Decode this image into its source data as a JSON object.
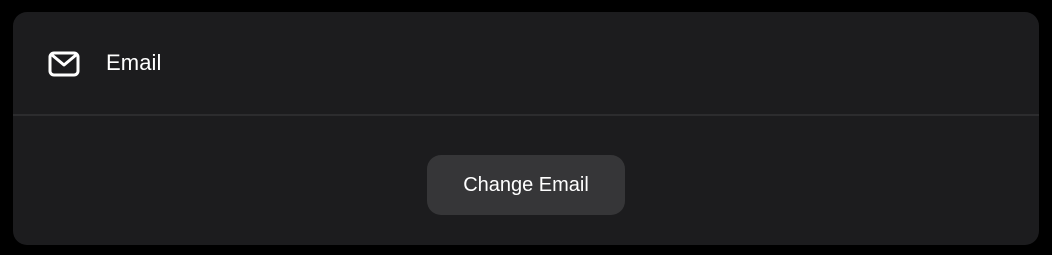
{
  "email_section": {
    "label": "Email",
    "icon": "mail-icon"
  },
  "actions": {
    "change_email_label": "Change Email"
  },
  "colors": {
    "background": "#000000",
    "card": "#1c1c1e",
    "divider": "#2c2c2e",
    "button": "#363638",
    "text": "#ffffff"
  }
}
